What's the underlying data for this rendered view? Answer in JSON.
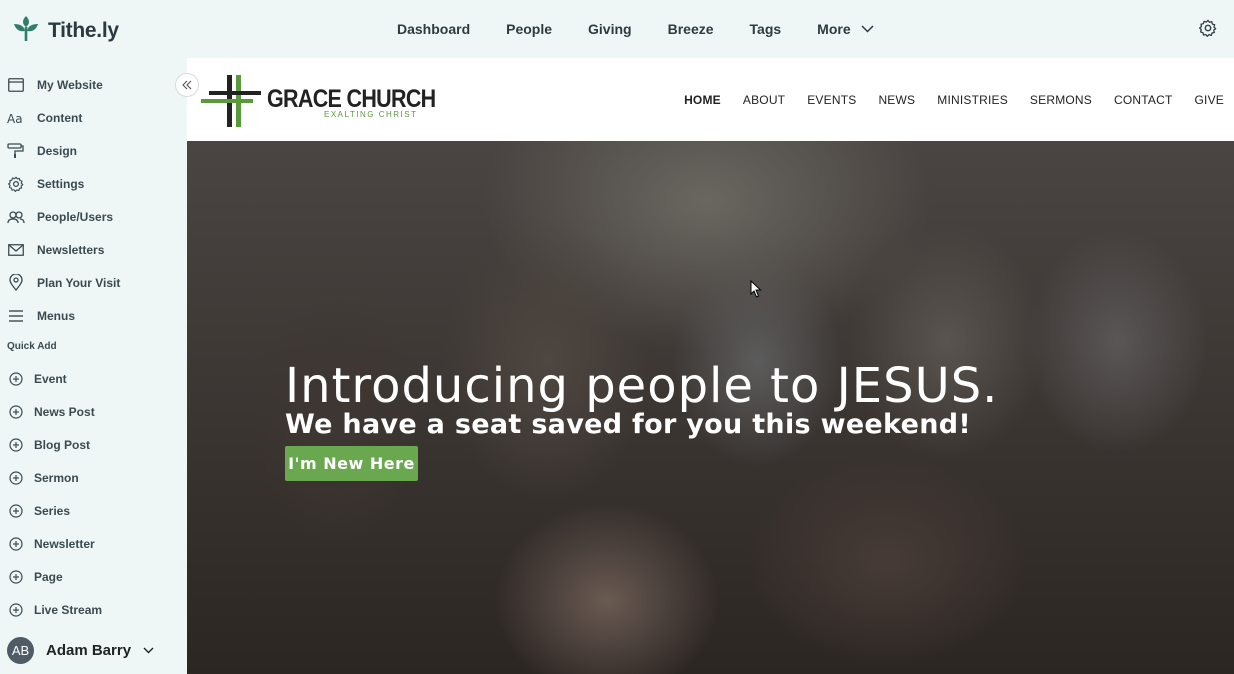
{
  "app": {
    "brand": "Tithe.ly",
    "topnav": [
      "Dashboard",
      "People",
      "Giving",
      "Breeze",
      "Tags",
      "More"
    ],
    "settings_icon": "gear-icon"
  },
  "sidebar": {
    "items": [
      {
        "label": "My Website",
        "icon": "browser-window-icon"
      },
      {
        "label": "Content",
        "icon": "text-aa-icon"
      },
      {
        "label": "Design",
        "icon": "paint-roller-icon"
      },
      {
        "label": "Settings",
        "icon": "gear-icon"
      },
      {
        "label": "People/Users",
        "icon": "users-icon"
      },
      {
        "label": "Newsletters",
        "icon": "envelope-icon"
      },
      {
        "label": "Plan Your Visit",
        "icon": "location-pin-icon"
      },
      {
        "label": "Menus",
        "icon": "hamburger-icon"
      }
    ],
    "quick_add_label": "Quick Add",
    "quick_add": [
      "Event",
      "News Post",
      "Blog Post",
      "Sermon",
      "Series",
      "Newsletter",
      "Page",
      "Live Stream"
    ],
    "user": {
      "initials": "AB",
      "name": "Adam Barry"
    }
  },
  "site": {
    "church_name": "GRACE CHURCH",
    "tagline": "EXALTING CHRIST",
    "nav": [
      "HOME",
      "ABOUT",
      "EVENTS",
      "NEWS",
      "MINISTRIES",
      "SERMONS",
      "CONTACT",
      "GIVE"
    ],
    "hero": {
      "title": "Introducing people to JESUS.",
      "subtitle": "We have a seat saved for you this weekend!",
      "cta": "I'm New Here"
    }
  },
  "colors": {
    "sidebar_bg": "#eef7f6",
    "brand_green": "#2f7d6b",
    "church_green": "#5a9a3c",
    "cta_green": "#6aa84f"
  }
}
